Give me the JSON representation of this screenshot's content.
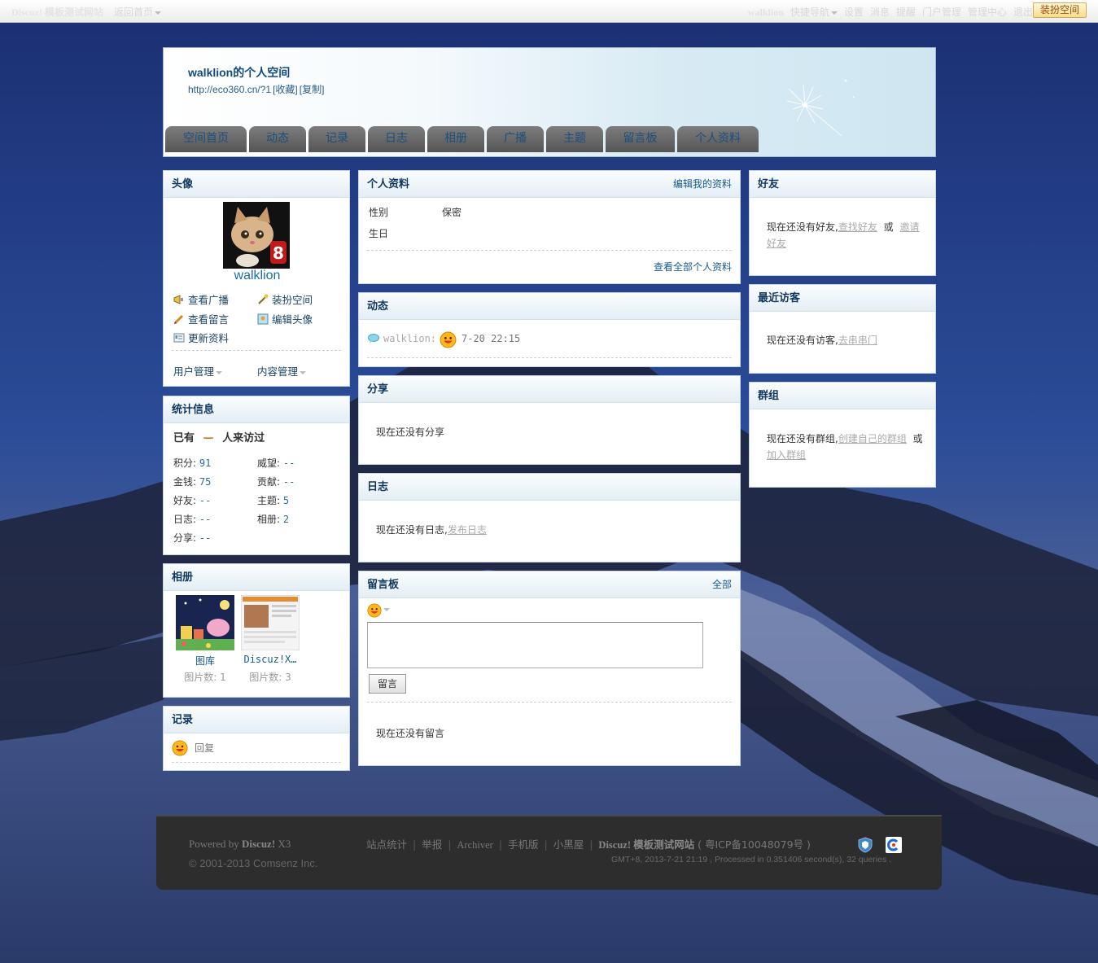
{
  "topbar": {
    "site_name": "Discuz! 模板测试网站",
    "back_home": "返回首页",
    "username": "walklion",
    "quick_nav": "快捷导航",
    "settings": "设置",
    "messages": "消息",
    "reminders": "提醒",
    "portal_manage": "门户管理",
    "admin_center": "管理中心",
    "logout": "退出",
    "dress_button": "装扮空间"
  },
  "header": {
    "title": "walklion的个人空间",
    "url": "http://eco360.cn/?1",
    "favorite": "[收藏]",
    "copy": "[复制]"
  },
  "nav": {
    "tabs": [
      {
        "label": "空间首页"
      },
      {
        "label": "动态"
      },
      {
        "label": "记录"
      },
      {
        "label": "日志"
      },
      {
        "label": "相册"
      },
      {
        "label": "广播"
      },
      {
        "label": "主题"
      },
      {
        "label": "留言板"
      },
      {
        "label": "个人资料"
      }
    ]
  },
  "avatar_box": {
    "title": "头像",
    "username": "walklion",
    "actions": [
      "查看广播",
      "装扮空间",
      "查看留言",
      "编辑头像",
      "更新资料"
    ],
    "user_manage": "用户管理",
    "content_manage": "内容管理"
  },
  "stats_box": {
    "title": "统计信息",
    "visitors_prefix": "已有",
    "visitors_value": "—",
    "visitors_suffix": "人来访过",
    "items": [
      {
        "label": "积分:",
        "value": "91"
      },
      {
        "label": "威望:",
        "value": "--"
      },
      {
        "label": "金钱:",
        "value": "75"
      },
      {
        "label": "贡献:",
        "value": "--"
      },
      {
        "label": "好友:",
        "value": "--"
      },
      {
        "label": "主题:",
        "value": "5"
      },
      {
        "label": "日志:",
        "value": "--"
      },
      {
        "label": "相册:",
        "value": "2"
      },
      {
        "label": "分享:",
        "value": "--"
      }
    ]
  },
  "album_box": {
    "title": "相册",
    "albums": [
      {
        "name": "图库",
        "count_label": "图片数: 1"
      },
      {
        "name": "Discuz!X…",
        "count_label": "图片数: 3"
      }
    ]
  },
  "record_box": {
    "title": "记录",
    "reply": "回复"
  },
  "profile_box": {
    "title": "个人资料",
    "edit": "编辑我的资料",
    "gender_label": "性别",
    "gender_value": "保密",
    "birthday_label": "生日",
    "view_all": "查看全部个人资料"
  },
  "feed_box": {
    "title": "动态",
    "user": "walklion",
    "time": "7-20 22:15"
  },
  "share_box": {
    "title": "分享",
    "empty": "现在还没有分享"
  },
  "blog_box": {
    "title": "日志",
    "empty": "现在还没有日志,",
    "publish": "发布日志"
  },
  "guestbook_box": {
    "title": "留言板",
    "all": "全部",
    "submit": "留言",
    "empty": "现在还没有留言"
  },
  "friends_box": {
    "title": "好友",
    "empty": "现在还没有好友,",
    "find": "查找好友",
    "or": "或",
    "invite": "邀请好友"
  },
  "visitors_box": {
    "title": "最近访客",
    "empty": "现在还没有访客,",
    "visit": "去串串门"
  },
  "groups_box": {
    "title": "群组",
    "empty": "现在还没有群组,",
    "create": "创建自己的群组",
    "or": "或",
    "join": "加入群组"
  },
  "footer": {
    "powered_prefix": "Powered by",
    "powered_brand": "Discuz!",
    "powered_version": "X3",
    "copyright": "© 2001-2013 Comsenz Inc.",
    "links": [
      "站点统计",
      "举报",
      "Archiver",
      "手机版",
      "小黑屋"
    ],
    "site_name": "Discuz! 模板测试网站",
    "icp": "( 粤ICP备10048079号 )",
    "debug": "GMT+8, 2013-7-21 21:19 , Processed in 0.351406 second(s), 32 queries ."
  },
  "colors": {
    "link": "#185a8e",
    "header_title": "#124b7a",
    "dress_button_text": "#a04a08"
  }
}
